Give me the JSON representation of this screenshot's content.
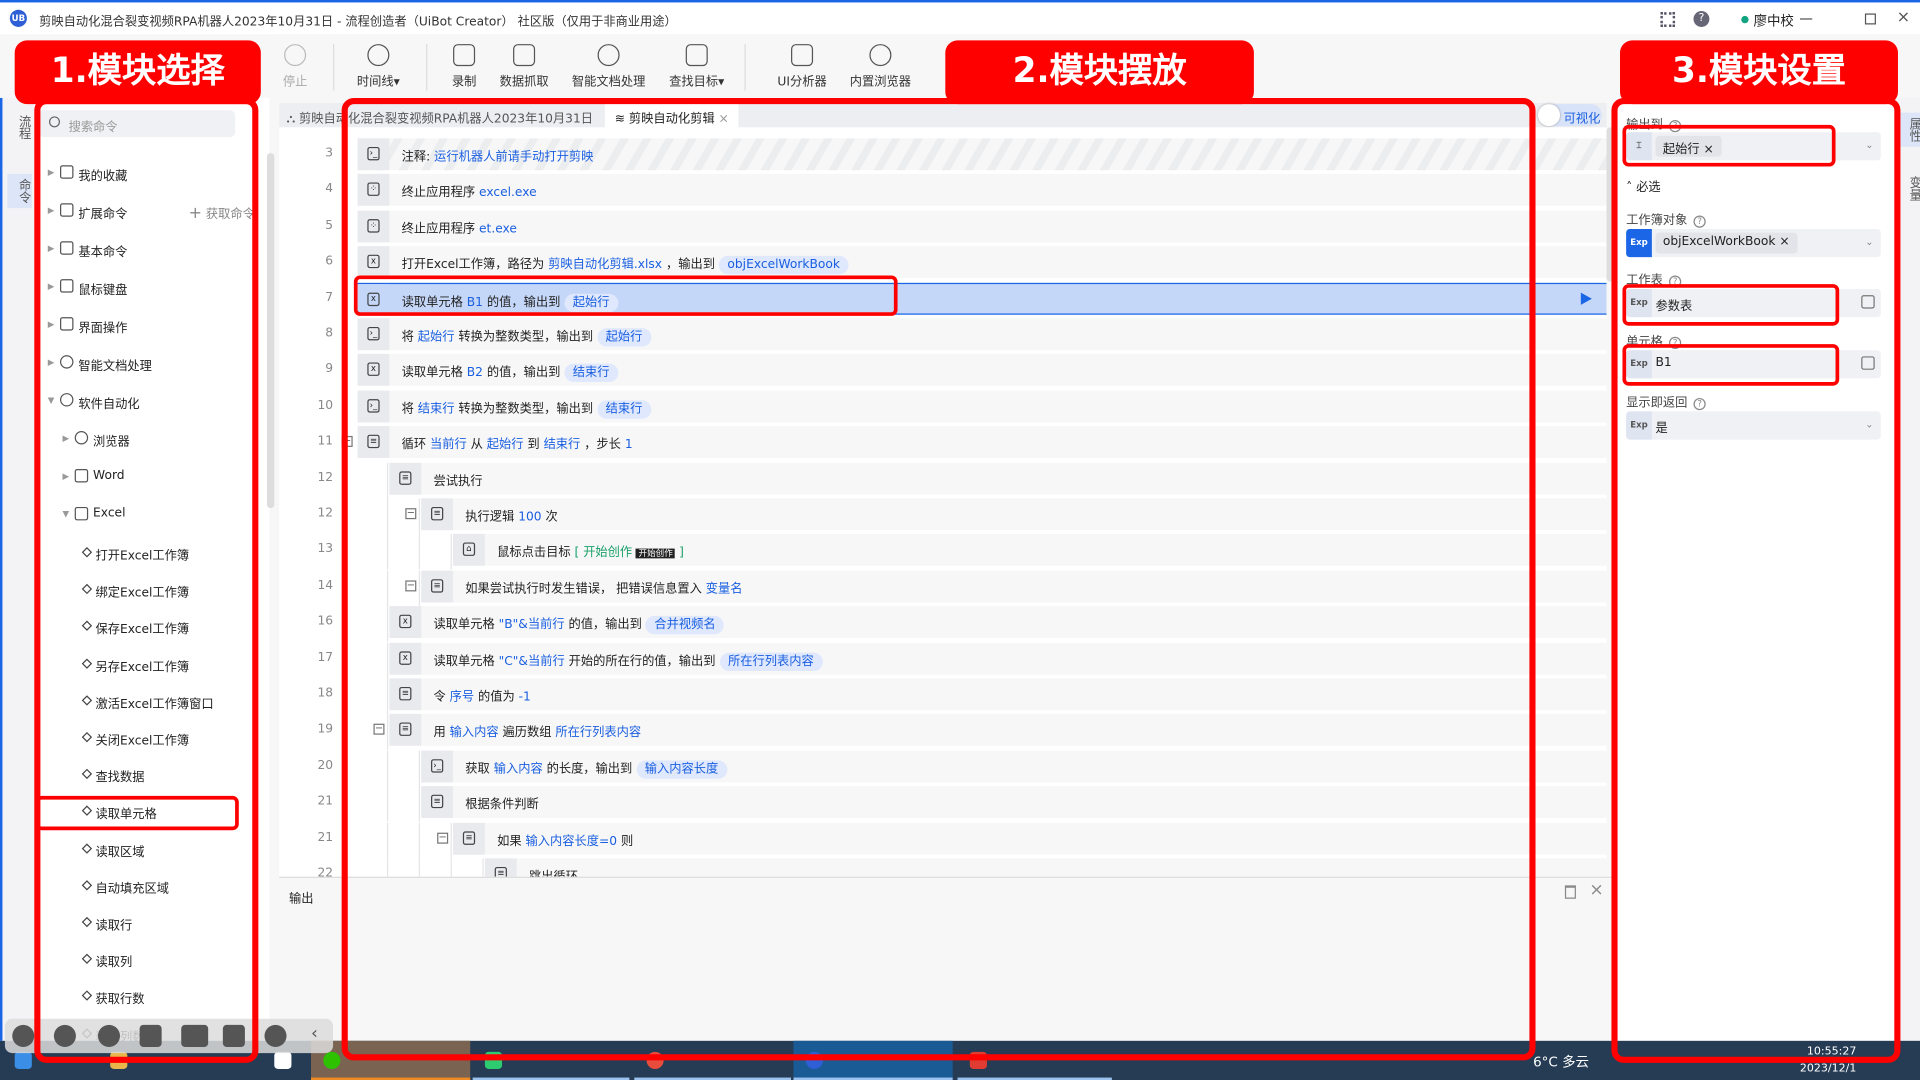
{
  "window": {
    "title": "剪映自动化混合裂变视频RPA机器人2023年10月31日 - 流程创造者（UiBot Creator） 社区版（仅用于非商业用途）",
    "user": "廖中校",
    "accent": "#1a66e6"
  },
  "toolbar": [
    {
      "label": "停止",
      "icon": "stop-icon",
      "disabled": true
    },
    {
      "label": "时间线▾",
      "icon": "clock-icon"
    },
    {
      "label": "录制",
      "icon": "record-icon"
    },
    {
      "label": "数据抓取",
      "icon": "data-scrape-icon"
    },
    {
      "label": "智能文档处理",
      "icon": "ai-doc-icon"
    },
    {
      "label": "查找目标▾",
      "icon": "find-target-icon"
    },
    {
      "label": "UI分析器",
      "icon": "ui-analyzer-icon"
    },
    {
      "label": "内置浏览器",
      "icon": "browser-icon"
    }
  ],
  "annotations": {
    "left": "1.模块选择",
    "middle": "2.模块摆放",
    "right": "3.模块设置",
    "color": "#ff0000"
  },
  "left_strip": {
    "tab1": "流程",
    "tab2": "命令"
  },
  "sidebar": {
    "search_placeholder": "搜索命令",
    "get_commands": "获取命令",
    "categories": [
      "我的收藏",
      "扩展命令",
      "基本命令",
      "鼠标键盘",
      "界面操作",
      "智能文档处理",
      "软件自动化"
    ],
    "software_children": [
      "浏览器",
      "Word",
      "Excel"
    ],
    "excel_items": [
      "打开Excel工作簿",
      "绑定Excel工作簿",
      "保存Excel工作簿",
      "另存Excel工作簿",
      "激活Excel工作簿窗口",
      "关闭Excel工作簿",
      "查找数据",
      "读取单元格",
      "读取区域",
      "自动填充区域",
      "读取行",
      "读取列",
      "获取行数",
      "获取列数"
    ],
    "selected_item": "读取单元格"
  },
  "tabs": [
    {
      "label": "剪映自动化混合裂变视频RPA机器人2023年10月31日"
    },
    {
      "label": "剪映自动化剪辑",
      "active": true
    }
  ],
  "visualize_label": "可视化",
  "editor_rows": [
    {
      "line": "3",
      "level": 0,
      "icon": "terminal",
      "striped": true,
      "parts": [
        [
          "注释: ",
          "n"
        ],
        [
          "运行机器人前请手动打开剪映",
          "v"
        ]
      ]
    },
    {
      "line": "4",
      "level": 0,
      "icon": "apps",
      "parts": [
        [
          "终止应用程序 ",
          "n"
        ],
        [
          "excel.exe",
          "v"
        ]
      ]
    },
    {
      "line": "5",
      "level": 0,
      "icon": "apps",
      "parts": [
        [
          "终止应用程序 ",
          "n"
        ],
        [
          "et.exe",
          "v"
        ]
      ]
    },
    {
      "line": "6",
      "level": 0,
      "icon": "excel",
      "parts": [
        [
          "打开Excel工作簿，路径为 ",
          "n"
        ],
        [
          "剪映自动化剪辑.xlsx",
          "v"
        ],
        [
          " ，输出到 ",
          "n"
        ],
        [
          "objExcelWorkBook",
          "chip"
        ]
      ]
    },
    {
      "line": "7",
      "level": 0,
      "icon": "excel",
      "selected": true,
      "parts": [
        [
          "读取单元格 ",
          "n"
        ],
        [
          "B1",
          "v"
        ],
        [
          " 的值，输出到 ",
          "n"
        ],
        [
          "起始行",
          "chip"
        ]
      ]
    },
    {
      "line": "8",
      "level": 0,
      "icon": "terminal",
      "parts": [
        [
          "将 ",
          "n"
        ],
        [
          "起始行",
          "v"
        ],
        [
          " 转换为整数类型，输出到 ",
          "n"
        ],
        [
          "起始行",
          "chip"
        ]
      ]
    },
    {
      "line": "9",
      "level": 0,
      "icon": "excel",
      "parts": [
        [
          "读取单元格 ",
          "n"
        ],
        [
          "B2",
          "v"
        ],
        [
          " 的值，输出到 ",
          "n"
        ],
        [
          "结束行",
          "chip"
        ]
      ]
    },
    {
      "line": "10",
      "level": 0,
      "icon": "terminal",
      "parts": [
        [
          "将 ",
          "n"
        ],
        [
          "结束行",
          "v"
        ],
        [
          " 转换为整数类型，输出到 ",
          "n"
        ],
        [
          "结束行",
          "chip"
        ]
      ]
    },
    {
      "line": "11",
      "level": 0,
      "icon": "block",
      "toggle": true,
      "parts": [
        [
          "循环 ",
          "n"
        ],
        [
          "当前行",
          "v"
        ],
        [
          " 从 ",
          "n"
        ],
        [
          "起始行",
          "v"
        ],
        [
          " 到 ",
          "n"
        ],
        [
          "结束行",
          "v"
        ],
        [
          " ，步长 ",
          "n"
        ],
        [
          "1",
          "v"
        ]
      ]
    },
    {
      "line": "12",
      "level": 1,
      "icon": "block",
      "parts": [
        [
          "尝试执行",
          "n"
        ]
      ]
    },
    {
      "line": "12",
      "level": 2,
      "icon": "block",
      "toggle": true,
      "parts": [
        [
          "执行逻辑 ",
          "n"
        ],
        [
          "100",
          "v"
        ],
        [
          " 次",
          "n"
        ]
      ]
    },
    {
      "line": "13",
      "level": 3,
      "icon": "mouse",
      "parts": [
        [
          "鼠标点击目标 ",
          "n"
        ],
        [
          "[ 开始创作 ",
          "g"
        ],
        [
          "开始创作",
          "img"
        ],
        [
          " ]",
          "g"
        ]
      ]
    },
    {
      "line": "14",
      "level": 2,
      "icon": "block",
      "toggle": true,
      "parts": [
        [
          "如果尝试执行时发生错误， 把错误信息置入 ",
          "n"
        ],
        [
          "变量名",
          "v"
        ]
      ]
    },
    {
      "line": "16",
      "level": 1,
      "icon": "excel",
      "parts": [
        [
          "读取单元格 ",
          "n"
        ],
        [
          "\"B\"&当前行",
          "v"
        ],
        [
          " 的值，输出到 ",
          "n"
        ],
        [
          "合并视频名",
          "chip"
        ]
      ]
    },
    {
      "line": "17",
      "level": 1,
      "icon": "excel",
      "parts": [
        [
          "读取单元格 ",
          "n"
        ],
        [
          "\"C\"&当前行",
          "v"
        ],
        [
          " 开始的所在行的值，输出到 ",
          "n"
        ],
        [
          "所在行列表内容",
          "chip"
        ]
      ]
    },
    {
      "line": "18",
      "level": 1,
      "icon": "block",
      "parts": [
        [
          "令 ",
          "n"
        ],
        [
          "序号",
          "v"
        ],
        [
          " 的值为 ",
          "n"
        ],
        [
          "-1",
          "v"
        ]
      ]
    },
    {
      "line": "19",
      "level": 1,
      "icon": "block",
      "toggle": true,
      "parts": [
        [
          "用 ",
          "n"
        ],
        [
          "输入内容",
          "v"
        ],
        [
          " 遍历数组 ",
          "n"
        ],
        [
          "所在行列表内容",
          "v"
        ]
      ]
    },
    {
      "line": "20",
      "level": 2,
      "icon": "terminal",
      "parts": [
        [
          "获取 ",
          "n"
        ],
        [
          "输入内容",
          "v"
        ],
        [
          " 的长度，输出到 ",
          "n"
        ],
        [
          "输入内容长度",
          "chip"
        ]
      ]
    },
    {
      "line": "21",
      "level": 2,
      "icon": "block",
      "parts": [
        [
          "根据条件判断",
          "n"
        ]
      ]
    },
    {
      "line": "21",
      "level": 3,
      "icon": "block",
      "toggle": true,
      "parts": [
        [
          "如果 ",
          "n"
        ],
        [
          "输入内容长度=0",
          "v"
        ],
        [
          " 则",
          "n"
        ]
      ]
    },
    {
      "line": "22",
      "level": 4,
      "icon": "block",
      "parts": [
        [
          "跳出循环",
          "n"
        ]
      ]
    }
  ],
  "output_panel": {
    "title": "输出"
  },
  "properties": {
    "output_label": "输出到",
    "output_value": "起始行",
    "section": "必选",
    "workbook_label": "工作簿对象",
    "workbook_value": "objExcelWorkBook",
    "sheet_label": "工作表",
    "sheet_value": "参数表",
    "cell_label": "单元格",
    "cell_value": "B1",
    "return_label": "显示即返回",
    "return_value": "是",
    "exp": "Exp"
  },
  "right_strip": {
    "tab1": "属性",
    "tab2": "变量"
  },
  "taskbar": {
    "weather": "6°C 多云",
    "time": "10:55:27",
    "date": "2023/12/1"
  }
}
